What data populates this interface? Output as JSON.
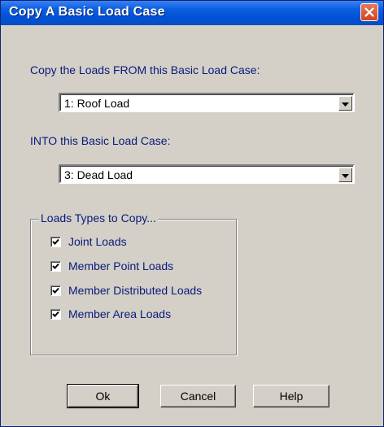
{
  "window": {
    "title": "Copy A Basic Load Case"
  },
  "from": {
    "label": "Copy the Loads FROM this Basic Load Case:",
    "selected": "1: Roof Load"
  },
  "into": {
    "label": "INTO this Basic Load Case:",
    "selected": "3: Dead Load"
  },
  "load_types": {
    "title": "Loads Types to Copy...",
    "items": [
      {
        "label": "Joint Loads",
        "checked": true
      },
      {
        "label": "Member Point Loads",
        "checked": true
      },
      {
        "label": "Member Distributed Loads",
        "checked": true
      },
      {
        "label": "Member Area Loads",
        "checked": true
      }
    ]
  },
  "buttons": {
    "ok": "Ok",
    "cancel": "Cancel",
    "help": "Help"
  },
  "icons": {
    "close": "close-icon",
    "dropdown": "chevron-down-icon",
    "check": "checkmark-icon"
  },
  "colors": {
    "titlebar": "#0050d8",
    "dialog_bg": "#d4d0c8",
    "label_text": "#0a1a7a",
    "close_button": "#d0441d"
  }
}
